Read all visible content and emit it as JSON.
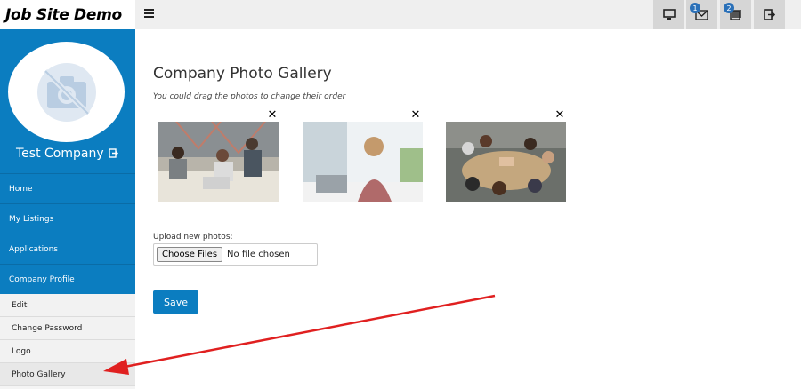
{
  "header": {
    "brand": "Job Site Demo",
    "menu_icon": "hamburger-icon",
    "buttons": [
      {
        "icon": "monitor-icon",
        "badge": ""
      },
      {
        "icon": "envelope-icon",
        "badge": "1"
      },
      {
        "icon": "stack-icon",
        "badge": "2"
      },
      {
        "icon": "logout-icon",
        "badge": ""
      }
    ]
  },
  "sidebar": {
    "company_name": "Test Company",
    "avatar_icon": "no-photo-icon",
    "nav": [
      {
        "label": "Home"
      },
      {
        "label": "My Listings"
      },
      {
        "label": "Applications"
      },
      {
        "label": "Company Profile"
      }
    ],
    "sub": [
      {
        "label": "Edit"
      },
      {
        "label": "Change Password"
      },
      {
        "label": "Logo"
      },
      {
        "label": "Photo Gallery",
        "active": true
      }
    ]
  },
  "main": {
    "title": "Company Photo Gallery",
    "hint": "You could drag the photos to change their order",
    "photos": [
      {
        "subject": "office-meeting-celebration"
      },
      {
        "subject": "woman-at-laptop"
      },
      {
        "subject": "team-hands-together"
      }
    ],
    "remove_glyph": "✕",
    "upload_label": "Upload new photos:",
    "choose_files": "Choose Files",
    "no_file": "No file chosen",
    "save": "Save"
  },
  "colors": {
    "accent": "#0b7dc0",
    "annotation": "#e02020"
  }
}
